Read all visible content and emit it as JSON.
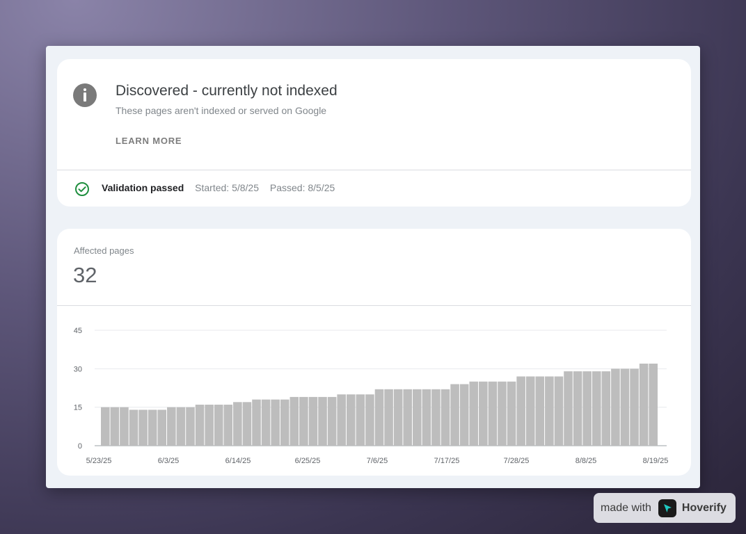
{
  "issue": {
    "title": "Discovered - currently not indexed",
    "subtitle": "These pages aren't indexed or served on Google",
    "learn_more": "LEARN MORE"
  },
  "validation": {
    "status": "Validation passed",
    "started": "Started: 5/8/25",
    "passed": "Passed: 8/5/25"
  },
  "affected": {
    "label": "Affected pages",
    "value": "32"
  },
  "chart_data": {
    "type": "bar",
    "title": "",
    "xlabel": "",
    "ylabel": "",
    "ylim": [
      0,
      45
    ],
    "y_ticks": [
      0,
      15,
      30,
      45
    ],
    "x_tick_labels": [
      "5/23/25",
      "6/3/25",
      "6/14/25",
      "6/25/25",
      "7/6/25",
      "7/17/25",
      "7/28/25",
      "8/8/25",
      "8/19/25"
    ],
    "grid": true,
    "bar_color": "#bdbdbd",
    "values": [
      15,
      15,
      15,
      14,
      14,
      14,
      14,
      15,
      15,
      15,
      16,
      16,
      16,
      16,
      17,
      17,
      18,
      18,
      18,
      18,
      19,
      19,
      19,
      19,
      19,
      20,
      20,
      20,
      20,
      22,
      22,
      22,
      22,
      22,
      22,
      22,
      22,
      24,
      24,
      25,
      25,
      25,
      25,
      25,
      27,
      27,
      27,
      27,
      27,
      29,
      29,
      29,
      29,
      29,
      30,
      30,
      30,
      32,
      32
    ]
  },
  "badge": {
    "prefix": "made with",
    "brand": "Hoverify"
  },
  "colors": {
    "success": "#1e8e3e",
    "info_icon": "#7a7a7a"
  },
  "icons": {
    "info": "info-icon",
    "check": "check-circle-icon",
    "brand_logo": "hoverify-logo-icon"
  }
}
